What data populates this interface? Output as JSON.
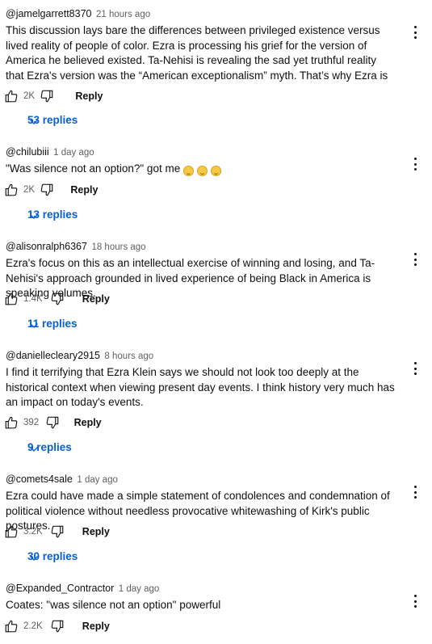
{
  "comments": [
    {
      "author": "@jamelgarrett8370",
      "time": "21 hours ago",
      "text": "This discussion lays bare the differences between  privileged existence versus lived reality of people of color. Ezra is processing his grief for the version of America he believed existed. Ta-Nehisi is revealing the sad yet truthful reality that Ezra's version was the “American exceptionalism” myth. That’s why Ezra is searching for meaning …",
      "likes": "2K",
      "reply_label": "Reply",
      "replies_label": "53 replies"
    },
    {
      "author": "@chilubiii",
      "time": "1 day ago",
      "text": "\"Was silence not an option?\" got me",
      "emoji": [
        "grinning-sweat-emoji",
        "grinning-sweat-emoji",
        "grinning-sweat-emoji"
      ],
      "likes": "2K",
      "reply_label": "Reply",
      "replies_label": "13 replies"
    },
    {
      "author": "@alisonralph6367",
      "time": "18 hours ago",
      "text": "Ezra's focus on this as an intellectual exercise of winning and losing, and Ta-Nehisi's approach grounded in lived experience of being Black in America is speaking volumes.",
      "likes": "1.4K",
      "reply_label": "Reply",
      "replies_label": "11 replies"
    },
    {
      "author": "@daniellecleary2915",
      "time": "8 hours ago",
      "text": "I find it terrifying that Ezra Klein says we should not look too deeply at the historical context when viewing present day events. I think history very much has an impact on today's events.",
      "likes": "392",
      "reply_label": "Reply",
      "replies_label": "9 replies"
    },
    {
      "author": "@comets4sale",
      "time": "1 day ago",
      "text": "Ezra could have made a simple statement of condolences and condemnation of political violence without needless provocative whitewashing of Kirk's public postures.",
      "likes": "3.2K",
      "reply_label": "Reply",
      "replies_label": "30 replies"
    },
    {
      "author": "@Expanded_Contractor",
      "time": "1 day ago",
      "text": "Coates: \"was silence not an option\" powerful",
      "likes": "2.2K",
      "reply_label": "Reply"
    }
  ],
  "colors": {
    "link": "#065fd4",
    "meta": "#606060",
    "text": "#0f0f0f"
  }
}
